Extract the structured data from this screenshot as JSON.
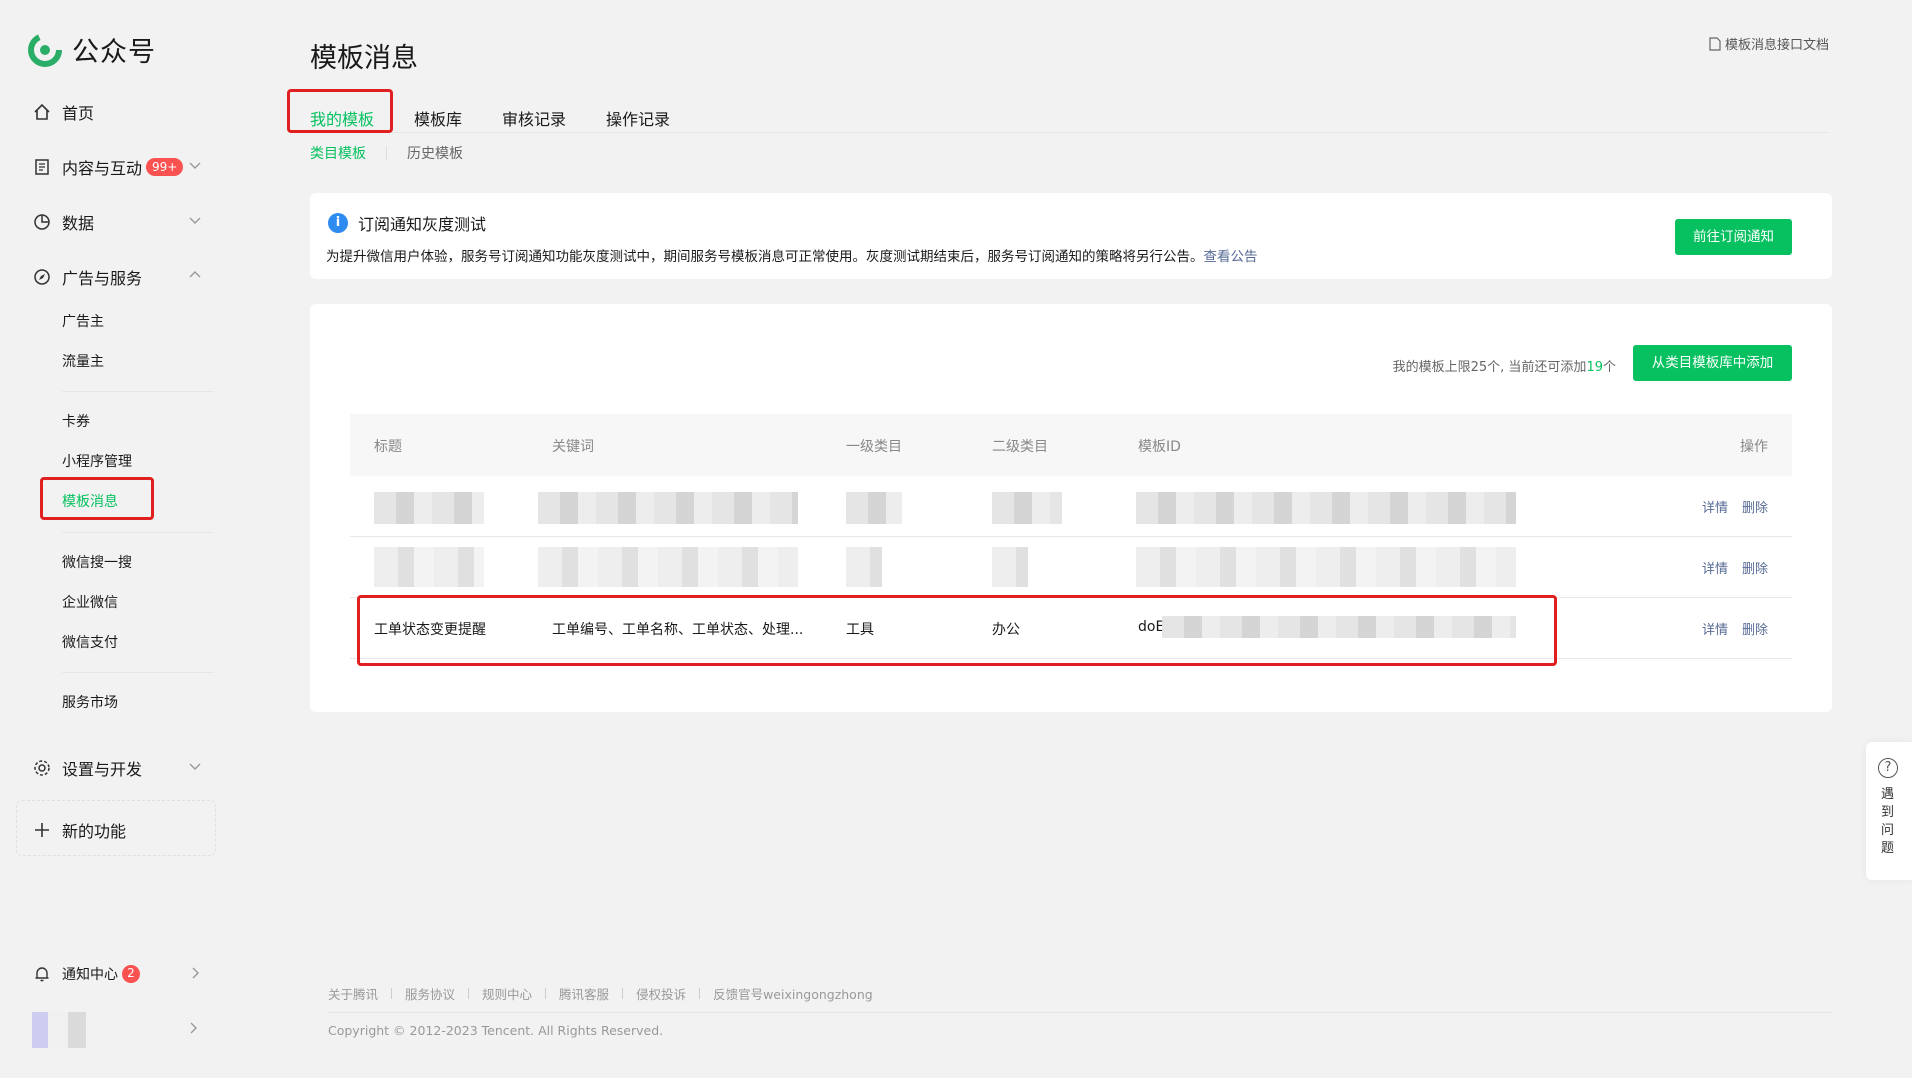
{
  "sidebar": {
    "logo_text": "公众号",
    "home": "首页",
    "content": "内容与互动",
    "content_badge": "99+",
    "data": "数据",
    "ads": "广告与服务",
    "sub": {
      "advertiser": "广告主",
      "publisher": "流量主",
      "coupon": "卡券",
      "miniprogram": "小程序管理",
      "template": "模板消息",
      "wxsearch": "微信搜一搜",
      "wework": "企业微信",
      "wxpay": "微信支付",
      "market": "服务市场"
    },
    "settings": "设置与开发",
    "new_feature": "新的功能",
    "notify": "通知中心",
    "notify_badge": "2"
  },
  "header": {
    "title": "模板消息",
    "doc_link": "模板消息接口文档"
  },
  "tabs": [
    "我的模板",
    "模板库",
    "审核记录",
    "操作记录"
  ],
  "subtabs": [
    "类目模板",
    "历史模板"
  ],
  "notice": {
    "title": "订阅通知灰度测试",
    "text": "为提升微信用户体验，服务号订阅通知功能灰度测试中，期间服务号模板消息可正常使用。灰度测试期结束后，服务号订阅通知的策略将另行公告。",
    "link": "查看公告",
    "button": "前往订阅通知"
  },
  "table_card": {
    "limit_prefix": "我的模板上限25个, 当前还可添加",
    "limit_num": "19",
    "limit_suffix": "个",
    "add_button": "从类目模板库中添加"
  },
  "table": {
    "headers": [
      "标题",
      "关键词",
      "一级类目",
      "二级类目",
      "模板ID",
      "操作"
    ],
    "rows": [
      {
        "title": "工单状态变更提醒",
        "keywords": "工单编号、工单名称、工单状态、处理...",
        "cat1": "工具",
        "cat2": "办公",
        "id_prefix": "doE"
      }
    ],
    "op_detail": "详情",
    "op_delete": "删除"
  },
  "footer": {
    "links": [
      "关于腾讯",
      "服务协议",
      "规则中心",
      "腾讯客服",
      "侵权投诉",
      "反馈官号weixingongzhong"
    ],
    "copyright": "Copyright © 2012-2023 Tencent. All Rights Reserved."
  },
  "help": {
    "text": "遇到问题"
  },
  "colors": {
    "accent": "#07c160",
    "link": "#576b95",
    "badge": "#fa5151",
    "highlight": "#e02020"
  }
}
